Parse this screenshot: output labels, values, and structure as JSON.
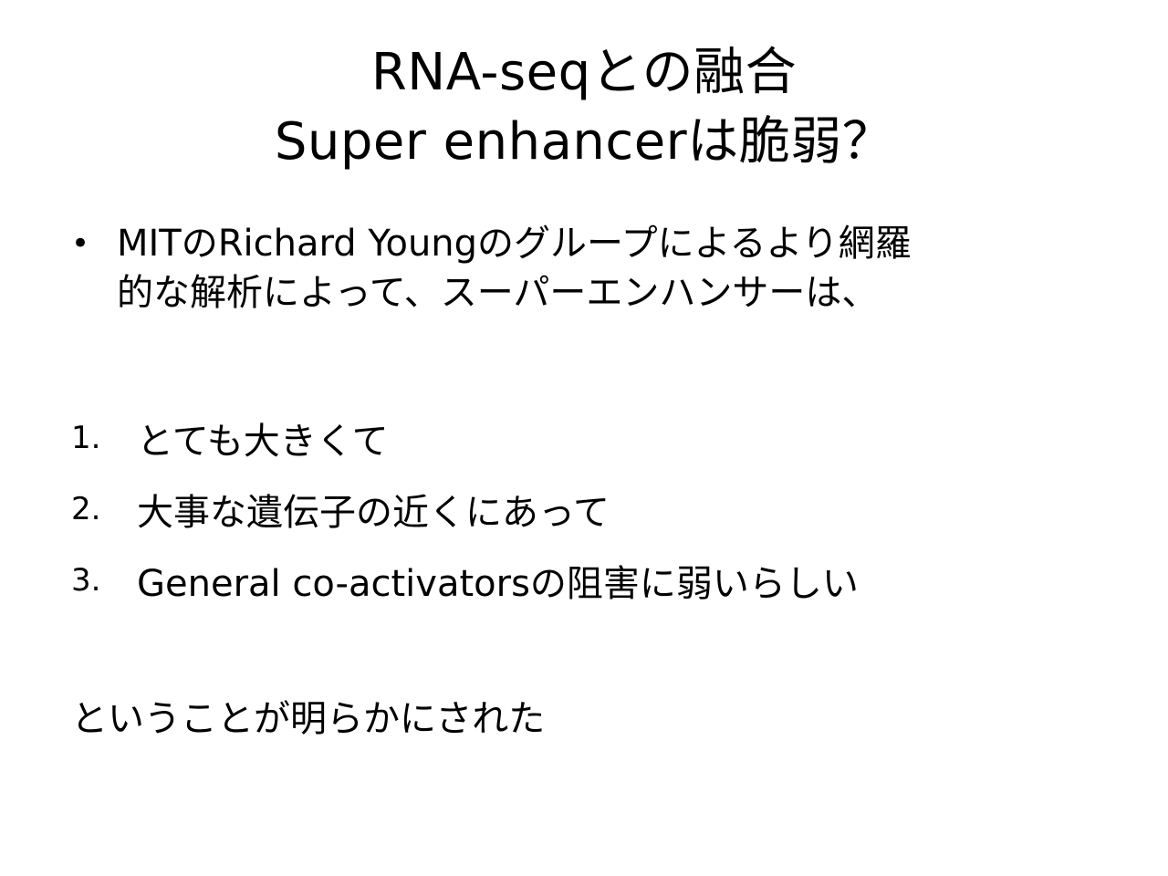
{
  "title": {
    "line1": "RNA-seqとの融合",
    "line2": "Super enhancerは脆弱？"
  },
  "bullet": {
    "marker": "•",
    "line1": "MITのRichard Youngのグループによるより網羅",
    "line2": "的な解析によって、スーパーエンハンサーは、"
  },
  "list": [
    {
      "number": "1.",
      "text": "とても大きくて"
    },
    {
      "number": "2.",
      "text": "大事な遺伝子の近くにあって"
    },
    {
      "number": "3.",
      "text": "General co-activatorsの阻害に弱いらしい"
    }
  ],
  "conclusion": "ということが明らかにされた"
}
